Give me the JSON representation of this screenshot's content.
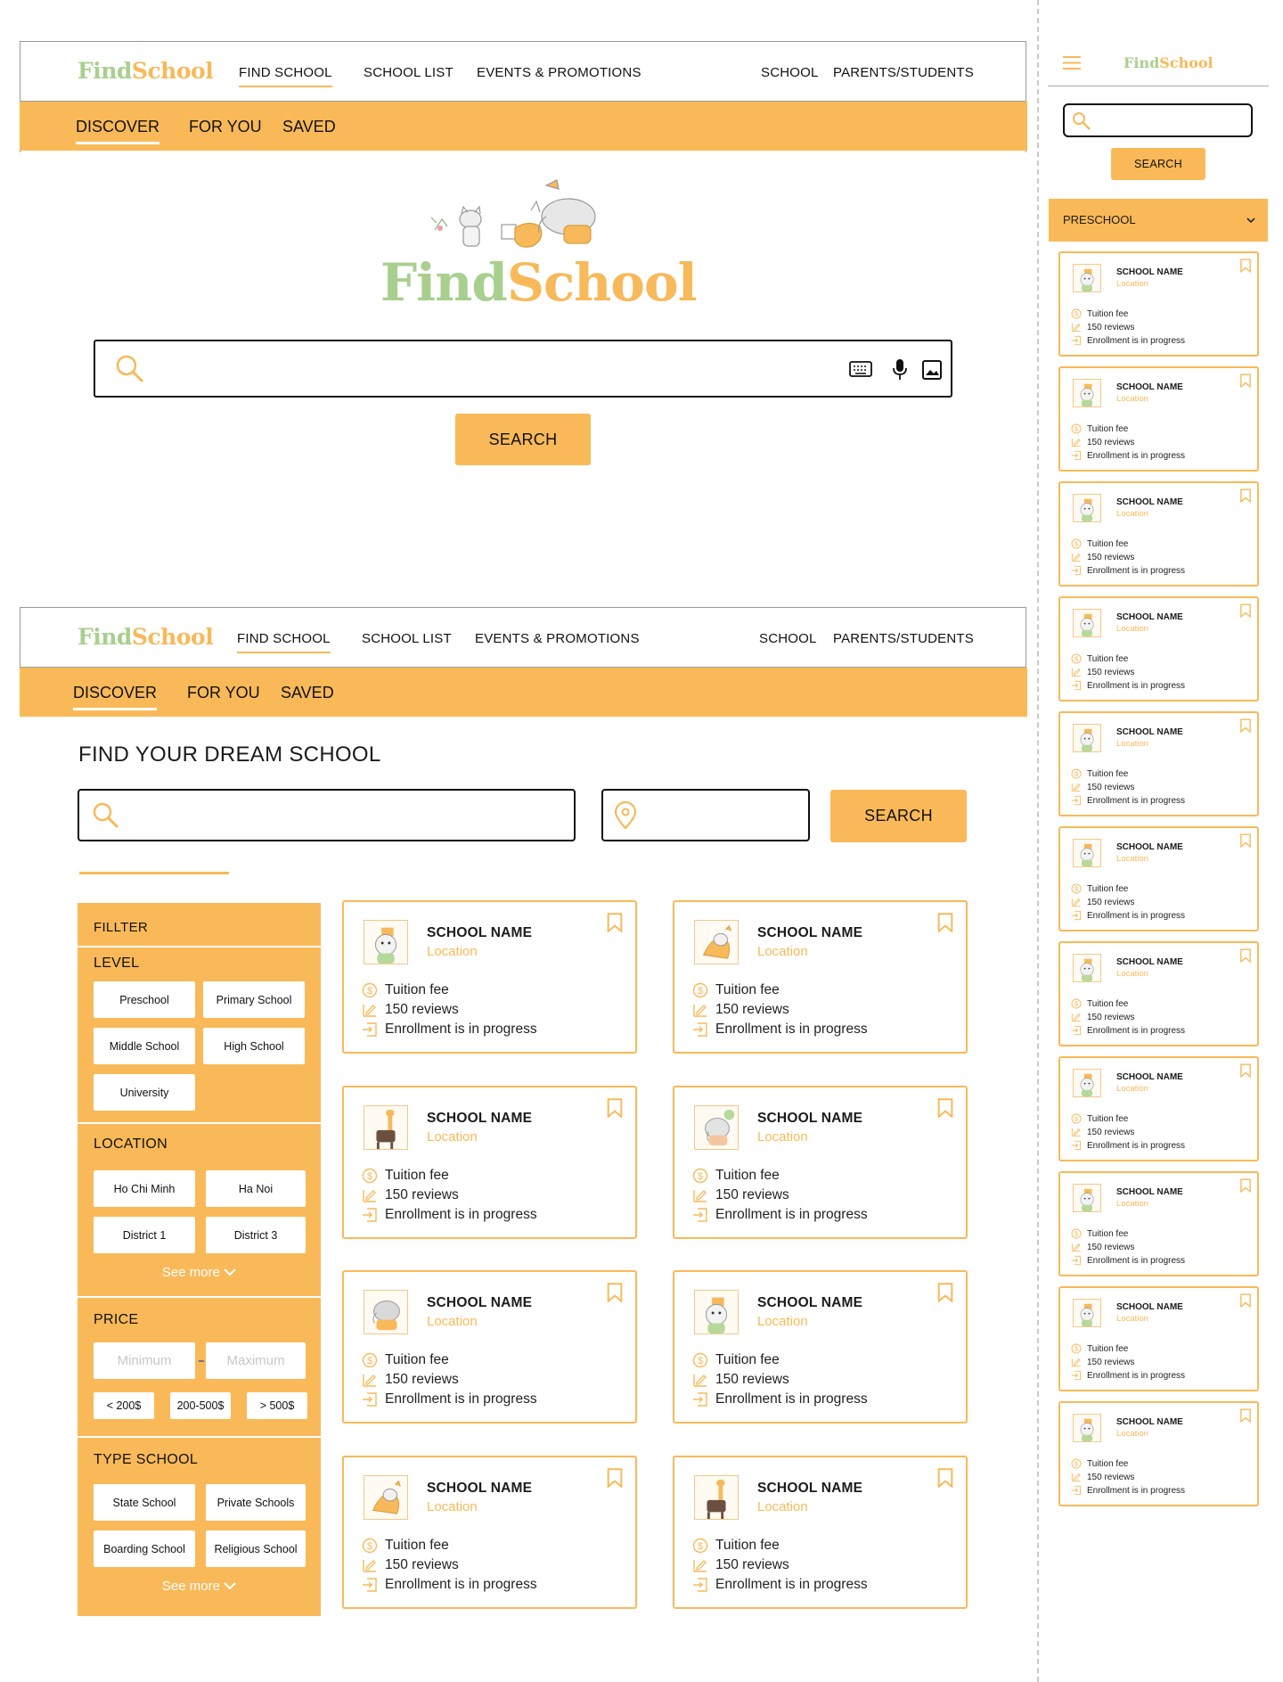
{
  "brand": {
    "part1": "Find",
    "part2": "School"
  },
  "nav": {
    "links": [
      "FIND SCHOOL",
      "SCHOOL LIST",
      "EVENTS & PROMOTIONS",
      "SCHOOL",
      "PARENTS/STUDENTS"
    ],
    "sub": [
      "DISCOVER",
      "FOR YOU",
      "SAVED"
    ]
  },
  "hero": {
    "search_label": "SEARCH"
  },
  "results": {
    "title": "FIND YOUR DREAM SCHOOL",
    "search_label": "SEARCH",
    "filter": {
      "title": "FILLTER",
      "level": {
        "title": "LEVEL",
        "options": [
          "Preschool",
          "Primary School",
          "Middle School",
          "High School",
          "University"
        ]
      },
      "location": {
        "title": "LOCATION",
        "options": [
          "Ho Chi Minh",
          "Ha Noi",
          "District 1",
          "District 3"
        ],
        "see_more": "See more"
      },
      "price": {
        "title": "PRICE",
        "min_placeholder": "Minimum",
        "max_placeholder": "Maximum",
        "ranges": [
          "< 200$",
          "200-500$",
          "> 500$"
        ]
      },
      "type": {
        "title": "TYPE SCHOOL",
        "options": [
          "State School",
          "Private Schools",
          "Boarding School",
          "Religious School"
        ],
        "see_more": "See more"
      }
    }
  },
  "card": {
    "name": "SCHOOL NAME",
    "location": "Location",
    "fee": "Tuition fee",
    "reviews": "150 reviews",
    "status": "Enrollment is in progress"
  },
  "mobile": {
    "search_label": "SEARCH",
    "category": "PRESCHOOL"
  },
  "icons": {
    "search": "search-icon",
    "keyboard": "keyboard-icon",
    "mic": "microphone-icon",
    "image": "image-icon",
    "location": "map-pin-icon",
    "bookmark": "bookmark-icon",
    "menu": "hamburger-menu-icon",
    "dollar": "dollar-icon",
    "review": "review-icon",
    "enroll": "enroll-arrow-icon",
    "chevron": "chevron-down-icon"
  },
  "colors": {
    "accent": "#f9b958",
    "brand_green": "#a9cf8e",
    "border": "#9a9a9a"
  }
}
